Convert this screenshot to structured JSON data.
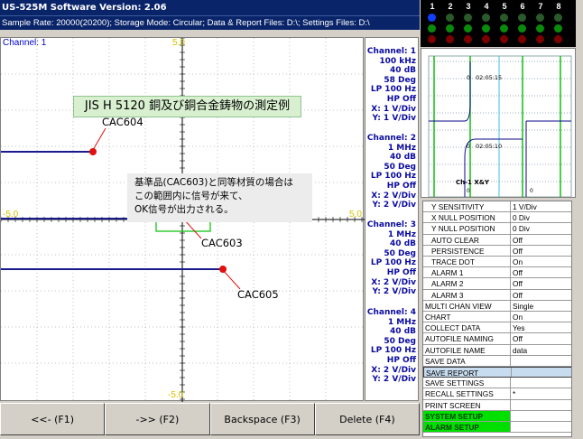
{
  "app": {
    "title": "US-525M Software Version: 2.06",
    "status_line": "Sample Rate: 20000(20200); Storage Mode: Circular; Data & Report Files: D:\\; Settings Files: D:\\"
  },
  "plot": {
    "channel_label": "Channel: 1",
    "top_scale": "5.0",
    "bottom_scale": "-5.0",
    "left_scale": "-5.0",
    "right_scale": "5.0",
    "title_box": "JIS H 5120 銅及び銅合金鋳物の測定例",
    "note_lines": [
      "基準品(CAC603)と同等材質の場合は",
      "この範囲内に信号が来て、",
      "OK信号が出力される。"
    ],
    "markers": [
      {
        "label": "CAC604"
      },
      {
        "label": "CAC603"
      },
      {
        "label": "CAC605"
      }
    ],
    "colors": {
      "trace": "#1a1a8c",
      "marker": "#e01010",
      "grid": "#c0c0c0",
      "axis": "#000000",
      "highlight_box": "#00c000",
      "arrow": "#e0b000"
    }
  },
  "channels": [
    {
      "name": "Channel: 1",
      "lines": [
        "100 kHz",
        "40 dB",
        "58 Deg",
        "LP 100 Hz",
        "HP Off",
        "X: 1 V/Div",
        "Y: 1 V/Div"
      ]
    },
    {
      "name": "Channel: 2",
      "lines": [
        "1 MHz",
        "40 dB",
        "50 Deg",
        "LP 100 Hz",
        "HP Off",
        "X: 2 V/Div",
        "Y: 2 V/Div"
      ]
    },
    {
      "name": "Channel: 3",
      "lines": [
        "1 MHz",
        "40 dB",
        "50 Deg",
        "LP 100 Hz",
        "HP Off",
        "X: 2 V/Div",
        "Y: 2 V/Div"
      ]
    },
    {
      "name": "Channel: 4",
      "lines": [
        "1 MHz",
        "40 dB",
        "50 Deg",
        "LP 100 Hz",
        "HP Off",
        "X: 2 V/Div",
        "Y: 2 V/Div"
      ]
    }
  ],
  "fkeys": [
    {
      "label": "<<- (F1)"
    },
    {
      "label": "->> (F2)"
    },
    {
      "label": "Backspace (F3)"
    },
    {
      "label": "Delete (F4)"
    }
  ],
  "leds": {
    "numbers": [
      "1",
      "2",
      "3",
      "4",
      "5",
      "6",
      "7",
      "8"
    ],
    "active_color": "#1040ff",
    "on_color": "#10c010",
    "off_color": "#7a0000"
  },
  "scope": {
    "time_labels": [
      "02:05:15",
      "02:05:10"
    ],
    "zero_labels": [
      "0",
      "0",
      "0",
      "0"
    ],
    "trace_label": "Ch-1  X&Y"
  },
  "settings": [
    {
      "name": "Y SENSITIVITY",
      "value": "1 V/Div",
      "indent": true
    },
    {
      "name": "X NULL POSITION",
      "value": "0 Div",
      "indent": true
    },
    {
      "name": "Y NULL POSITION",
      "value": "0 Div",
      "indent": true
    },
    {
      "name": "AUTO CLEAR",
      "value": "Off",
      "indent": true
    },
    {
      "name": "PERSISTENCE",
      "value": "Off",
      "indent": true
    },
    {
      "name": "TRACE DOT",
      "value": "On",
      "indent": true
    },
    {
      "name": "ALARM 1",
      "value": "Off",
      "indent": true
    },
    {
      "name": "ALARM 2",
      "value": "Off",
      "indent": true
    },
    {
      "name": "ALARM 3",
      "value": "Off",
      "indent": true
    },
    {
      "name": "MULTI CHAN VIEW",
      "value": "Single"
    },
    {
      "name": "CHART",
      "value": "On"
    },
    {
      "name": "COLLECT DATA",
      "value": "Yes"
    },
    {
      "name": "AUTOFILE NAMING",
      "value": "Off"
    },
    {
      "name": "AUTOFILE NAME",
      "value": "data"
    },
    {
      "name": "SAVE DATA",
      "value": ""
    },
    {
      "name": "SAVE REPORT",
      "value": "",
      "selected": true
    },
    {
      "name": "SAVE SETTINGS",
      "value": ""
    },
    {
      "name": "RECALL SETTINGS",
      "value": "*"
    },
    {
      "name": "PRINT SCREEN",
      "value": ""
    },
    {
      "name": "SYSTEM SETUP",
      "value": "",
      "green": true
    },
    {
      "name": "ALARM SETUP",
      "value": "",
      "green": true
    }
  ]
}
